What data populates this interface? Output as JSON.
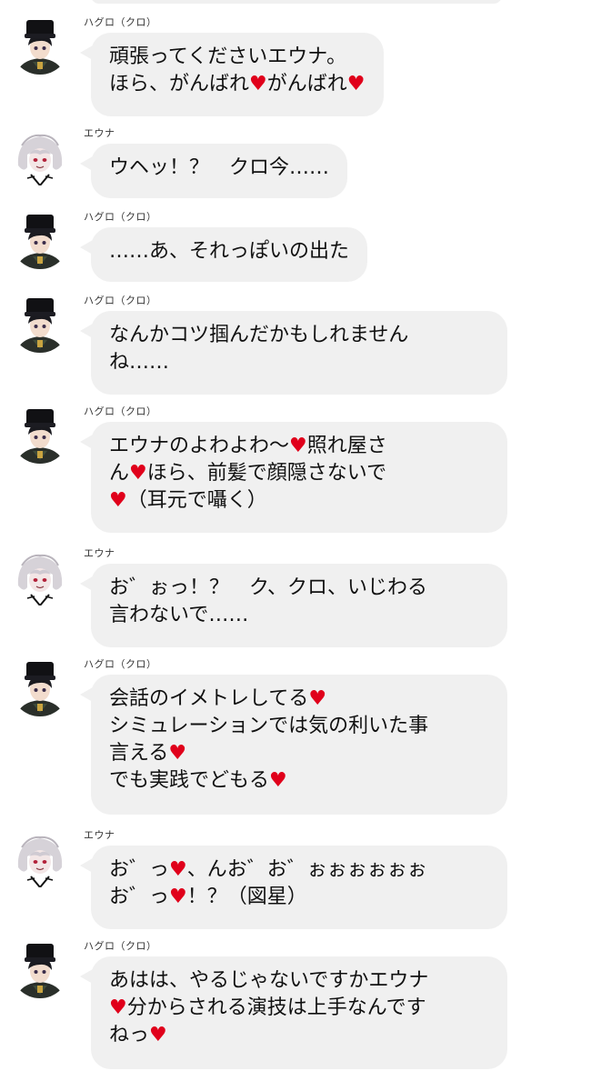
{
  "chat": {
    "messages": [
      {
        "speaker": "ハグロ（クロ）",
        "avatar": "kuro-avatar",
        "lines": [
          [
            "頑張ってくださいエウナ。"
          ],
          [
            "ほら、がんばれ",
            "♥",
            "がんばれ",
            "♥"
          ]
        ]
      },
      {
        "speaker": "エウナ",
        "avatar": "euna-avatar",
        "lines": [
          [
            "ウヘッ！？　クロ今……"
          ]
        ]
      },
      {
        "speaker": "ハグロ（クロ）",
        "avatar": "kuro-avatar",
        "lines": [
          [
            "……あ、それっぽいの出た"
          ]
        ]
      },
      {
        "speaker": "ハグロ（クロ）",
        "avatar": "kuro-avatar",
        "lines": [
          [
            "なんかコツ掴んだかもしれません"
          ],
          [
            "ね……"
          ]
        ]
      },
      {
        "speaker": "ハグロ（クロ）",
        "avatar": "kuro-avatar",
        "lines": [
          [
            "エウナのよわよわ～",
            "♥",
            "照れ屋さ"
          ],
          [
            "ん",
            "♥",
            "ほら、前髪で顔隠さないで"
          ],
          [
            "♥",
            "（耳元で囁く）"
          ]
        ]
      },
      {
        "speaker": "エウナ",
        "avatar": "euna-avatar",
        "lines": [
          [
            "お゛ぉっ！？　ク、クロ、いじわる"
          ],
          [
            "言わないで……"
          ]
        ]
      },
      {
        "speaker": "ハグロ（クロ）",
        "avatar": "kuro-avatar",
        "lines": [
          [
            "会話のイメトレしてる",
            "♥"
          ],
          [
            "シミュレーションでは気の利いた事"
          ],
          [
            "言える",
            "♥"
          ],
          [
            "でも実践でどもる",
            "♥"
          ]
        ]
      },
      {
        "speaker": "エウナ",
        "avatar": "euna-avatar",
        "lines": [
          [
            "お゛っ",
            "♥",
            "、んお゛お゛ぉぉぉぉぉぉ"
          ],
          [
            "お゛っ",
            "♥",
            "！？（図星）"
          ]
        ]
      },
      {
        "speaker": "ハグロ（クロ）",
        "avatar": "kuro-avatar",
        "lines": [
          [
            "あはは、やるじゃないですかエウナ"
          ],
          [
            "♥",
            "分からされる演技は上手なんです"
          ],
          [
            "ねっ",
            "♥"
          ]
        ]
      }
    ]
  },
  "colors": {
    "bubble": "#f0f0f0",
    "heart": "#e0001b",
    "background": "#ffffff"
  }
}
